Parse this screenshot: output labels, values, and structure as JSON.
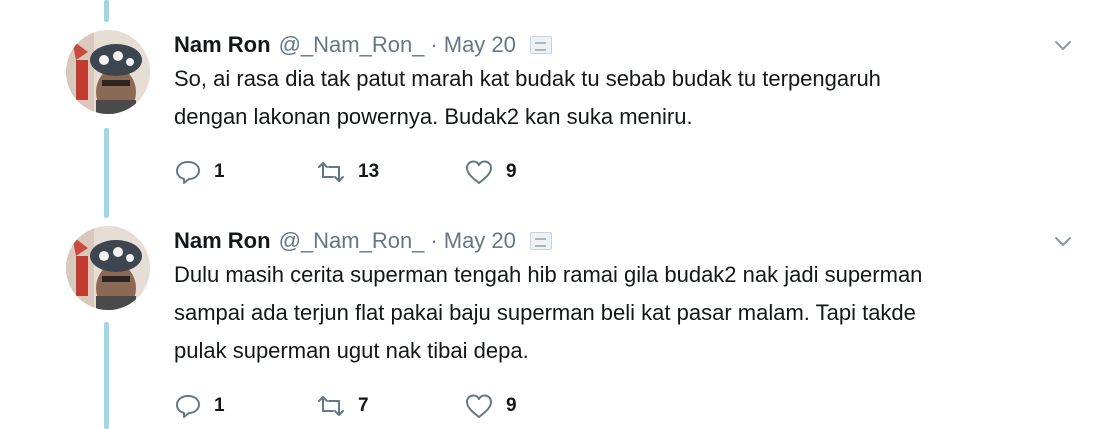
{
  "tweets": [
    {
      "author_name": "Nam Ron",
      "handle": "@_Nam_Ron_",
      "separator": "·",
      "date": "May 20",
      "text_lines": [
        "So, ai rasa dia tak patut marah kat budak tu sebab budak tu terpengaruh",
        "dengan lakonan powernya. Budak2 kan suka meniru."
      ],
      "replies": "1",
      "retweets": "13",
      "likes": "9"
    },
    {
      "author_name": "Nam Ron",
      "handle": "@_Nam_Ron_",
      "separator": "·",
      "date": "May 20",
      "text_lines": [
        "Dulu masih cerita superman tengah hib ramai gila budak2 nak jadi superman",
        "sampai ada terjun flat pakai baju superman beli kat pasar malam. Tapi takde",
        "pulak superman ugut nak tibai depa."
      ],
      "replies": "1",
      "retweets": "7",
      "likes": "9"
    }
  ],
  "icons": {
    "reply": "reply-icon",
    "retweet": "retweet-icon",
    "like": "heart-icon",
    "menu": "chevron-down-icon"
  },
  "colors": {
    "thread_line": "#9fd7ea",
    "secondary_text": "#657786",
    "icon_gray": "#657786"
  }
}
